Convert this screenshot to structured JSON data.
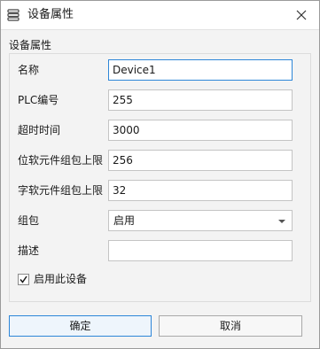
{
  "window": {
    "title": "设备属性",
    "icon": "device-list-icon"
  },
  "group": {
    "title": "设备属性"
  },
  "fields": {
    "name": {
      "label": "名称",
      "value": "Device1"
    },
    "plc_no": {
      "label": "PLC编号",
      "value": "255"
    },
    "timeout": {
      "label": "超时时间",
      "value": "3000"
    },
    "bit_limit": {
      "label": "位软元件组包上限",
      "value": "256"
    },
    "word_limit": {
      "label": "字软元件组包上限",
      "value": "32"
    },
    "packing": {
      "label": "组包",
      "value": "启用"
    },
    "description": {
      "label": "描述",
      "value": ""
    }
  },
  "enable": {
    "label": "启用此设备",
    "checked": true
  },
  "buttons": {
    "ok": "确定",
    "cancel": "取消"
  },
  "colors": {
    "accent": "#2d86d8"
  }
}
